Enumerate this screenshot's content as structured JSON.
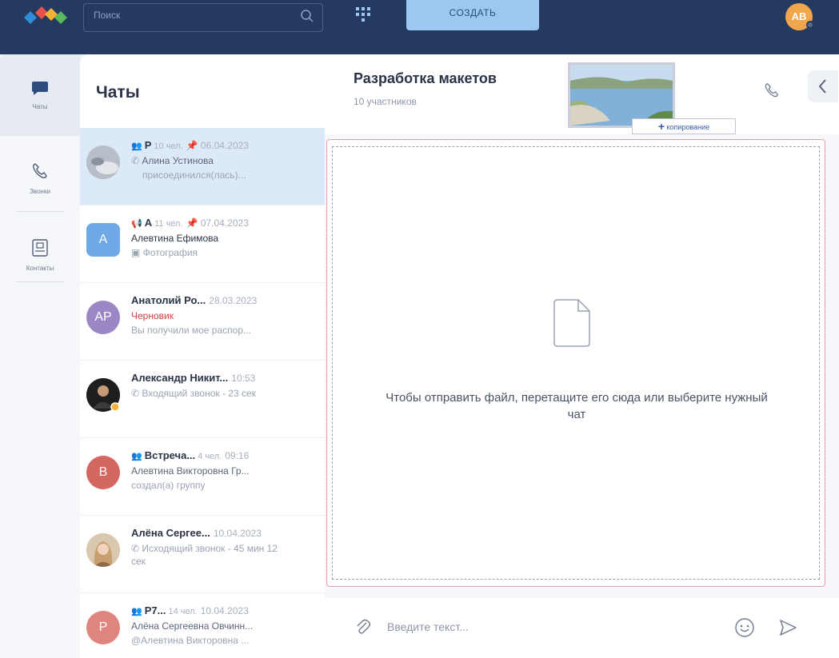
{
  "header": {
    "search_placeholder": "Поиск",
    "create_label": "создать",
    "avatar_initials": "АВ",
    "search_icon": "search-icon",
    "apps_icon": "apps-grid-icon",
    "logo": "logo-icon"
  },
  "rail": {
    "items": [
      {
        "label": "Чаты",
        "icon": "chat-bubble-icon",
        "active": true
      },
      {
        "label": "Звонки",
        "icon": "phone-icon",
        "active": false
      },
      {
        "label": "Контакты",
        "icon": "contacts-icon",
        "active": false
      }
    ]
  },
  "chat_list": {
    "title": "Чаты",
    "items": [
      {
        "name": "Р",
        "count": "10 чел.",
        "date": "06.04.2023",
        "line1": "Алина Устинова",
        "line2": "присоединился(лась)...",
        "selected": true
      },
      {
        "name": "А",
        "count": "11 чел.",
        "date": "07.04.2023",
        "line1": "Алевтина Ефимова",
        "line2": "Фотография",
        "avatar": "A"
      },
      {
        "name": "Анатолий Ро...",
        "date": "28.03.2023",
        "line1": "Черновик",
        "line2": "Вы получили мое распор...",
        "avatar": "AP"
      },
      {
        "name": "Александр Никит...",
        "date": "10:53",
        "line1": "Входящий звонок - 23 сек"
      },
      {
        "name": "Встреча...",
        "count": "4 чел.",
        "date": "09:16",
        "line1": "Алевтина Викторовна Гр...",
        "line2": "создал(а) группу",
        "avatar": "В"
      },
      {
        "name": "Алёна Сергее...",
        "date": "10.04.2023",
        "line1": "Исходящий звонок - 45 мин 12 сек"
      },
      {
        "name": "Р7...",
        "count": "14 чел.",
        "date": "10.04.2023",
        "line1": "Алёна Сергеевна Овчинн...",
        "line2": "@Алевтина Викторовна ...",
        "avatar": "Р"
      }
    ]
  },
  "conversation": {
    "title": "Разработка макетов",
    "subtitle": "10 участников",
    "copy_badge": "копирование",
    "dropzone_text": "Чтобы отправить файл, перетащите его сюда или выберите нужный чат",
    "input_placeholder": "Введите текст..."
  },
  "colors": {
    "topbar": "#243a60",
    "create_button": "#9cc8f0",
    "selected_row": "#dce9f8",
    "draft_red": "#d04141",
    "dropzone_border": "#e7a0a8"
  }
}
